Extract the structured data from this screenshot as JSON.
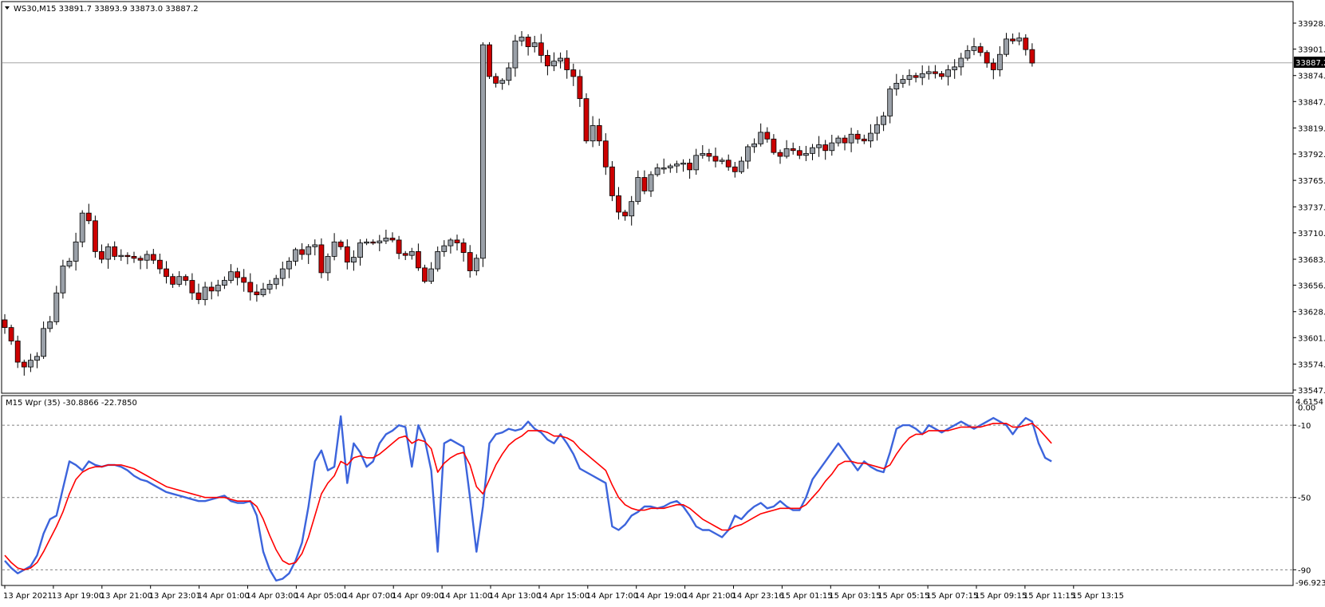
{
  "main_panel": {
    "header_text": "WS30,M15  33891.7 33893.9 33873.0 33887.2",
    "current_price_label": "33887.2",
    "current_price": 33887.2
  },
  "indicator_panel": {
    "header_text": "M15 Wpr (35) -30.8866 -22.7850",
    "scale_top_label": "4.6154",
    "scale_bottom_label": "-96.9231",
    "levels": [
      "-10",
      "-50",
      "-90"
    ]
  },
  "chart_data": [
    {
      "type": "candlestick",
      "symbol": "WS30",
      "timeframe": "M15",
      "ylim": [
        33547.0,
        33945.0
      ],
      "y_ticks": [
        "33928.5",
        "33901.5",
        "33874.0",
        "33847.0",
        "33819.5",
        "33792.5",
        "33765.0",
        "33737.5",
        "33710.5",
        "33683.0",
        "33656.0",
        "33628.5",
        "33601.5",
        "33574.0",
        "33547.0"
      ],
      "grid": false,
      "colors": {
        "bull": "#9aa0a8",
        "bear": "#cc0000",
        "wick": "#000000",
        "price_line": "#a6a6a6"
      },
      "closes": [
        33612,
        33598,
        33576,
        33571,
        33578,
        33582,
        33611,
        33618,
        33648,
        33676,
        33681,
        33701,
        33731,
        33723,
        33691,
        33683,
        33696,
        33686,
        33687,
        33686,
        33684,
        33682,
        33688,
        33682,
        33673,
        33665,
        33657,
        33665,
        33661,
        33648,
        33641,
        33654,
        33650,
        33656,
        33661,
        33670,
        33664,
        33659,
        33649,
        33646,
        33652,
        33657,
        33663,
        33673,
        33681,
        33693,
        33688,
        33696,
        33698,
        33669,
        33686,
        33701,
        33696,
        33680,
        33685,
        33700,
        33701,
        33700,
        33702,
        33705,
        33703,
        33689,
        33687,
        33691,
        33674,
        33660,
        33673,
        33691,
        33697,
        33703,
        33700,
        33690,
        33671,
        33684,
        33906,
        33873,
        33866,
        33869,
        33882,
        33910,
        33914,
        33904,
        33908,
        33895,
        33884,
        33889,
        33892,
        33880,
        33873,
        33850,
        33806,
        33822,
        33806,
        33779,
        33749,
        33732,
        33728,
        33743,
        33768,
        33754,
        33771,
        33778,
        33778,
        33780,
        33782,
        33783,
        33776,
        33791,
        33793,
        33790,
        33785,
        33786,
        33779,
        33774,
        33785,
        33800,
        33803,
        33815,
        33808,
        33794,
        33790,
        33798,
        33796,
        33791,
        33793,
        33799,
        33802,
        33796,
        33804,
        33809,
        33804,
        33813,
        33808,
        33806,
        33814,
        33823,
        33832,
        33860,
        33866,
        33870,
        33874,
        33872,
        33876,
        33878,
        33876,
        33873,
        33880,
        33883,
        33892,
        33900,
        33904,
        33898,
        33887,
        33880,
        33896,
        33912,
        33910,
        33913,
        33901,
        33887
      ]
    },
    {
      "type": "line",
      "title": "M15 Wpr (35)",
      "ylim": [
        -96.9231,
        4.6154
      ],
      "levels": [
        -10,
        -50,
        -90
      ],
      "series": [
        {
          "color": "#3c64dc",
          "values": [
            -85,
            -89,
            -92,
            -90,
            -88,
            -82,
            -70,
            -62,
            -60,
            -45,
            -30,
            -32,
            -35,
            -30,
            -32,
            -33,
            -32,
            -32,
            -33,
            -35,
            -38,
            -40,
            -41,
            -43,
            -45,
            -47,
            -48,
            -49,
            -50,
            -51,
            -52,
            -52,
            -51,
            -50,
            -49,
            -52,
            -53,
            -53,
            -52,
            -60,
            -80,
            -90,
            -96,
            -95,
            -92,
            -85,
            -75,
            -55,
            -30,
            -24,
            -35,
            -33,
            -5,
            -42,
            -20,
            -25,
            -33,
            -30,
            -20,
            -15,
            -13,
            -10,
            -11,
            -33,
            -10,
            -18,
            -35,
            -80,
            -20,
            -18,
            -20,
            -22,
            -50,
            -80,
            -55,
            -20,
            -15,
            -14,
            -12,
            -13,
            -12,
            -8,
            -12,
            -14,
            -18,
            -20,
            -15,
            -20,
            -26,
            -34,
            -36,
            -38,
            -40,
            -42,
            -66,
            -68,
            -65,
            -60,
            -58,
            -55,
            -55,
            -56,
            -55,
            -53,
            -52,
            -55,
            -60,
            -66,
            -68,
            -68,
            -70,
            -72,
            -68,
            -60,
            -62,
            -58,
            -55,
            -53,
            -56,
            -55,
            -52,
            -55,
            -57,
            -57,
            -50,
            -40,
            -35,
            -30,
            -25,
            -20,
            -25,
            -30,
            -35,
            -30,
            -33,
            -35,
            -36,
            -25,
            -12,
            -10,
            -10,
            -12,
            -15,
            -10,
            -12,
            -14,
            -12,
            -10,
            -8,
            -10,
            -12,
            -10,
            -8,
            -6,
            -8,
            -10,
            -15,
            -10,
            -6,
            -8,
            -20,
            -28,
            -30
          ]
        },
        {
          "color": "#ff0000",
          "values": [
            -82,
            -86,
            -89,
            -90,
            -89,
            -86,
            -80,
            -73,
            -66,
            -58,
            -48,
            -40,
            -36,
            -34,
            -33,
            -33,
            -32,
            -32,
            -32,
            -33,
            -34,
            -36,
            -38,
            -40,
            -42,
            -44,
            -45,
            -46,
            -47,
            -48,
            -49,
            -50,
            -50,
            -50,
            -50,
            -51,
            -52,
            -52,
            -52,
            -55,
            -62,
            -71,
            -79,
            -85,
            -87,
            -86,
            -81,
            -72,
            -60,
            -48,
            -42,
            -38,
            -30,
            -32,
            -28,
            -27,
            -28,
            -28,
            -26,
            -23,
            -20,
            -17,
            -16,
            -20,
            -18,
            -19,
            -23,
            -36,
            -31,
            -28,
            -26,
            -25,
            -32,
            -44,
            -48,
            -40,
            -32,
            -26,
            -21,
            -18,
            -16,
            -13,
            -13,
            -13,
            -14,
            -16,
            -16,
            -17,
            -19,
            -23,
            -26,
            -29,
            -32,
            -35,
            -43,
            -50,
            -54,
            -56,
            -57,
            -57,
            -56,
            -56,
            -56,
            -55,
            -54,
            -54,
            -56,
            -59,
            -62,
            -64,
            -66,
            -68,
            -68,
            -66,
            -65,
            -63,
            -61,
            -59,
            -58,
            -57,
            -56,
            -56,
            -56,
            -56,
            -54,
            -50,
            -46,
            -41,
            -37,
            -32,
            -30,
            -30,
            -31,
            -31,
            -32,
            -33,
            -34,
            -32,
            -26,
            -21,
            -17,
            -15,
            -15,
            -13,
            -13,
            -13,
            -13,
            -12,
            -11,
            -11,
            -11,
            -11,
            -10,
            -9,
            -9,
            -9,
            -11,
            -11,
            -10,
            -9,
            -12,
            -16,
            -20
          ]
        }
      ]
    }
  ],
  "time_axis": {
    "labels": [
      "13 Apr 2021",
      "13 Apr 19:00",
      "13 Apr 21:00",
      "13 Apr 23:01",
      "14 Apr 01:00",
      "14 Apr 03:00",
      "14 Apr 05:00",
      "14 Apr 07:00",
      "14 Apr 09:00",
      "14 Apr 11:00",
      "14 Apr 13:00",
      "14 Apr 15:00",
      "14 Apr 17:00",
      "14 Apr 19:00",
      "14 Apr 21:00",
      "14 Apr 23:16",
      "15 Apr 01:15",
      "15 Apr 03:15",
      "15 Apr 05:15",
      "15 Apr 07:15",
      "15 Apr 09:15",
      "15 Apr 11:15",
      "15 Apr 13:15"
    ]
  }
}
